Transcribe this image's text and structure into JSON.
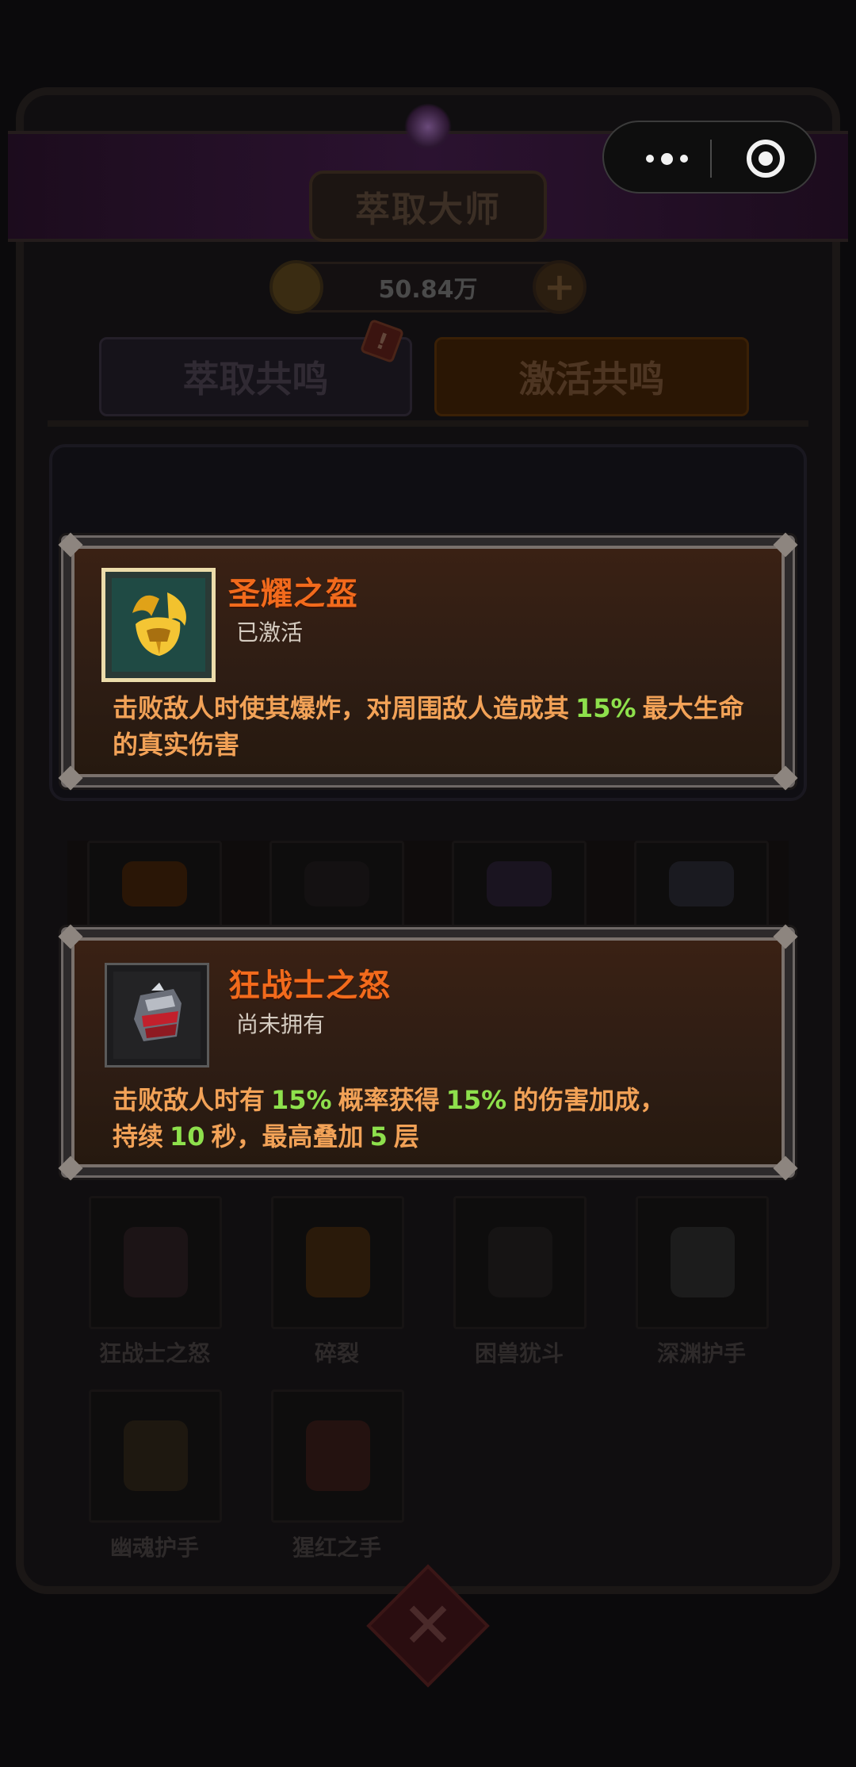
{
  "background": {
    "title": "萃取大师",
    "coin_value": "50.84万",
    "tabs": [
      "萃取共鸣",
      "激活共鸣"
    ],
    "badge": "!",
    "grid_labels": [
      "狂战士之怒",
      "碎裂",
      "困兽犹斗",
      "深渊护手",
      "幽魂护手",
      "猩红之手"
    ]
  },
  "cards": [
    {
      "name": "圣耀之盔",
      "status": "已激活",
      "desc_parts": [
        "击败敌人时使其爆炸，对周围敌人造成其",
        "15%",
        "最大生命的真实伤害"
      ],
      "icon": "golden-horned-helmet-icon"
    },
    {
      "name": "狂战士之怒",
      "status": "尚未拥有",
      "desc_parts": [
        "击败敌人时有",
        "15%",
        "概率获得",
        "15%",
        "的伤害加成，",
        "持续",
        "10",
        "秒，最高叠加",
        "5",
        "层"
      ],
      "icon": "red-gauntlet-icon"
    }
  ],
  "colors": {
    "title": "#f26a1c",
    "description": "#f2a257",
    "highlight_number": "#8ee04c",
    "icon_frame_active": "#e8d9a0"
  }
}
